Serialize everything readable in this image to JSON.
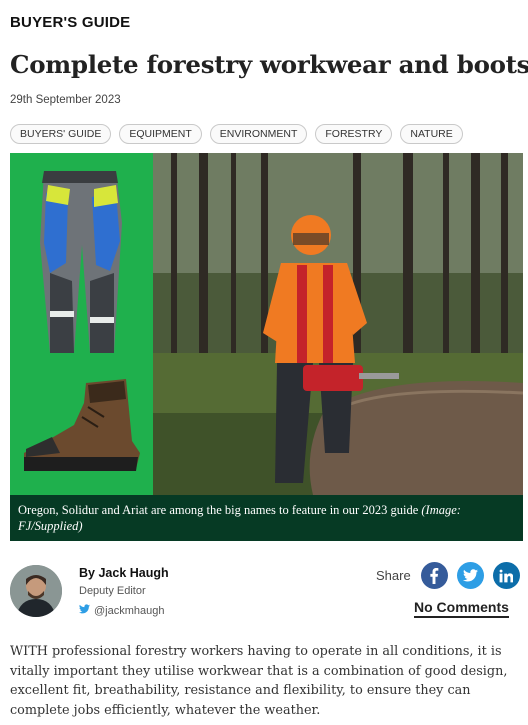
{
  "article": {
    "kicker": "BUYER'S GUIDE",
    "headline": "Complete forestry workwear and boots",
    "date": "29th September 2023",
    "tags": [
      "BUYERS' GUIDE",
      "EQUIPMENT",
      "ENVIRONMENT",
      "FORESTRY",
      "NATURE"
    ],
    "image": {
      "caption": "Oregon, Solidur and Ariat are among the big names to feature in our 2023 guide",
      "credit": "(Image: FJ/Supplied)"
    },
    "author": {
      "prefix": "By",
      "name": "Jack Haugh",
      "role": "Deputy Editor",
      "handle": "@jackmhaugh"
    },
    "share": {
      "label": "Share",
      "icons": [
        "facebook-icon",
        "twitter-icon",
        "linkedin-icon"
      ]
    },
    "comments_label": "No Comments",
    "body": "WITH professional forestry workers having to operate in all conditions, it is vitally important they utilise workwear that is a combination of good design, excellent fit, breathability, resistance and flexibility, to ensure they can complete jobs efficiently, whatever the weather."
  },
  "colors": {
    "caption_bg": "#063a24",
    "product_panel_bg": "#1fb04d",
    "facebook": "#355b9a",
    "twitter": "#2e9ee5",
    "linkedin": "#0c6da9"
  }
}
